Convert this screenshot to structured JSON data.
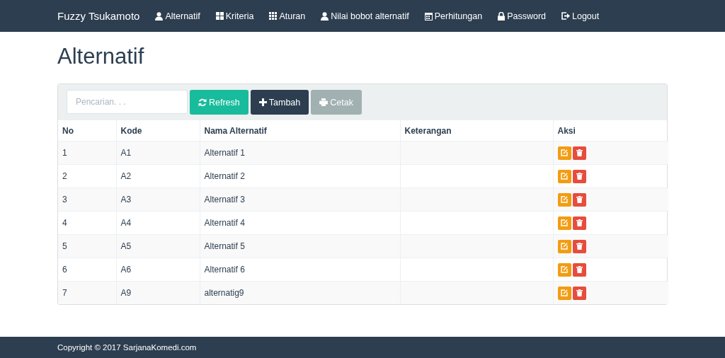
{
  "navbar": {
    "brand": "Fuzzy Tsukamoto",
    "items": [
      {
        "label": "Alternatif",
        "kind": "user"
      },
      {
        "label": "Kriteria",
        "kind": "grid4"
      },
      {
        "label": "Aturan",
        "kind": "grid9"
      },
      {
        "label": "Nilai bobot alternatif",
        "kind": "user"
      },
      {
        "label": "Perhitungan",
        "kind": "calendar"
      },
      {
        "label": "Password",
        "kind": "lock"
      },
      {
        "label": "Logout",
        "kind": "logout"
      }
    ]
  },
  "page_title": "Alternatif",
  "toolbar": {
    "search": {
      "placeholder": "Pencarian. . ."
    },
    "buttons": [
      {
        "label": "Refresh",
        "kind": "refresh",
        "disabled": false
      },
      {
        "label": "Tambah",
        "kind": "add",
        "disabled": false
      },
      {
        "label": "Cetak",
        "kind": "print",
        "disabled": true
      }
    ]
  },
  "table": {
    "columns": [
      "No",
      "Kode",
      "Nama Alternatif",
      "Keterangan",
      "Aksi"
    ],
    "rows": [
      {
        "no": "1",
        "kode": "A1",
        "nama": "Alternatif 1"
      },
      {
        "no": "2",
        "kode": "A2",
        "nama": "Alternatif 2"
      },
      {
        "no": "3",
        "kode": "A3",
        "nama": "Alternatif 3"
      },
      {
        "no": "4",
        "kode": "A4",
        "nama": "Alternatif 4"
      },
      {
        "no": "5",
        "kode": "A5",
        "nama": "Alternatif 5"
      },
      {
        "no": "6",
        "kode": "A6",
        "nama": "Alternatif 6"
      },
      {
        "no": "7",
        "kode": "A9",
        "nama": "alternatig9"
      }
    ]
  },
  "footer": "Copyright © 2017 SarjanaKomedi.com"
}
